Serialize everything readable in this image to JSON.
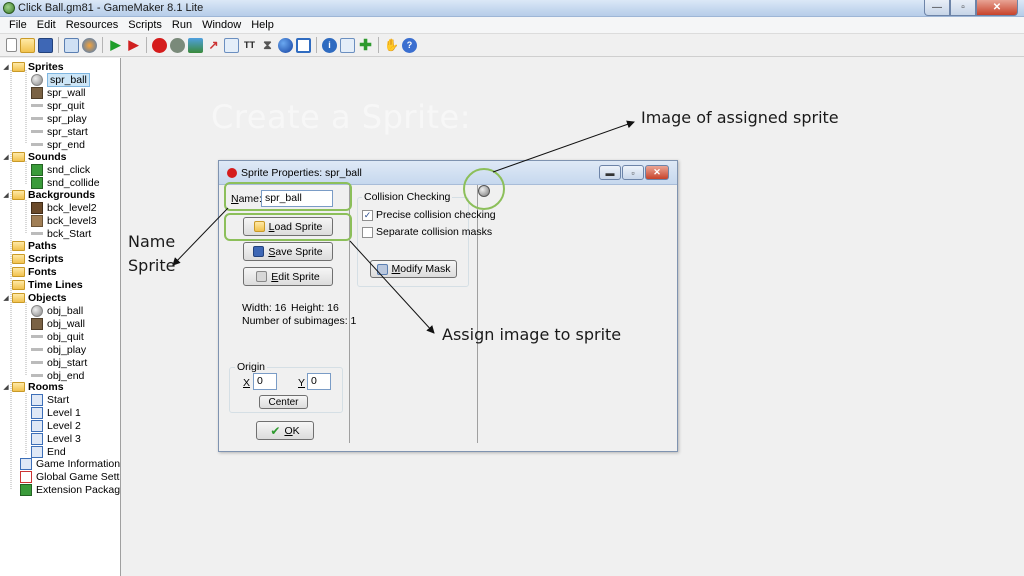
{
  "window": {
    "title": "Click Ball.gm81 - GameMaker 8.1 Lite",
    "buttons": [
      "—",
      "▫",
      "✕"
    ]
  },
  "menubar": [
    "File",
    "Edit",
    "Resources",
    "Scripts",
    "Run",
    "Window",
    "Help"
  ],
  "toolbar": {
    "icons": [
      "new-file-icon",
      "open-icon",
      "save-icon",
      "create-executable-icon",
      "publish-icon",
      "run-icon",
      "debug-icon",
      "add-sprite-icon",
      "add-sound-icon",
      "add-background-icon",
      "add-path-icon",
      "add-script-icon",
      "add-font-icon",
      "add-timeline-icon",
      "add-object-icon",
      "add-room-icon",
      "game-info-icon",
      "global-settings-icon",
      "extension-icon",
      "upgrade-icon",
      "help-icon"
    ],
    "separator_after": [
      2,
      4,
      6,
      16,
      18
    ]
  },
  "tree": {
    "folders": {
      "sprites": "Sprites",
      "sounds": "Sounds",
      "backgrounds": "Backgrounds",
      "paths": "Paths",
      "scripts": "Scripts",
      "fonts": "Fonts",
      "timelines": "Time Lines",
      "objects": "Objects",
      "rooms": "Rooms"
    },
    "sprites": [
      "spr_ball",
      "spr_wall",
      "spr_quit",
      "spr_play",
      "spr_start",
      "spr_end"
    ],
    "sounds": [
      "snd_click",
      "snd_collide"
    ],
    "backgrounds": [
      "bck_level2",
      "bck_level3",
      "bck_Start"
    ],
    "objects": [
      "obj_ball",
      "obj_wall",
      "obj_quit",
      "obj_play",
      "obj_start",
      "obj_end"
    ],
    "rooms": [
      "Start",
      "Level 1",
      "Level 2",
      "Level 3",
      "End"
    ],
    "extras": [
      "Game Information",
      "Global Game Settings",
      "Extension Packages"
    ]
  },
  "slide": {
    "title": "Create a Sprite:",
    "annotations": {
      "image_of_sprite": "Image of assigned sprite",
      "name_sprite_1": "Name",
      "name_sprite_2": "Sprite",
      "assign_image": "Assign image to sprite"
    }
  },
  "dialog": {
    "title": "Sprite Properties: spr_ball",
    "name_label_u": "N",
    "name_label_rest": "ame:",
    "name_value": "spr_ball",
    "load_u": "L",
    "load_rest": "oad Sprite",
    "save_u": "S",
    "save_rest": "ave Sprite",
    "edit_u": "E",
    "edit_rest": "dit Sprite",
    "width_text": "Width: 16",
    "height_text": "Height: 16",
    "subimages_text": "Number of subimages: 1",
    "origin_label": "Origin",
    "x_label": "X",
    "x_value": "0",
    "y_label": "Y",
    "y_value": "0",
    "center_label": "Center",
    "ok_u": "O",
    "ok_rest": "K",
    "collision": {
      "group_label": "Collision Checking",
      "precise_label": "Precise collision checking",
      "precise_checked": true,
      "separate_label": "Separate collision masks",
      "separate_checked": false,
      "modify_u": "M",
      "modify_rest": "odify Mask"
    }
  },
  "colors": {
    "highlight": "#8cbf5a",
    "slide_title": "#f7f7f7"
  }
}
